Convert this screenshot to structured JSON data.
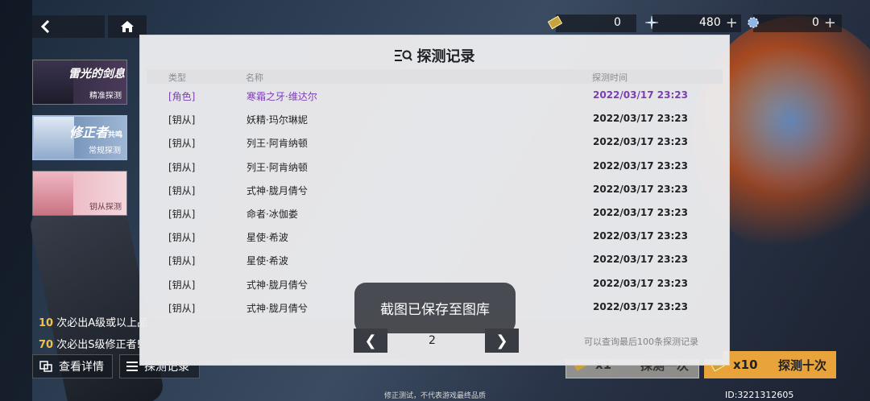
{
  "currencies": [
    {
      "icon": "ticket-icon",
      "value": "0",
      "has_plus": false
    },
    {
      "icon": "crystal-icon",
      "value": "480",
      "has_plus": true
    },
    {
      "icon": "snowflake-gem-icon",
      "value": "0",
      "has_plus": true
    }
  ],
  "banners": [
    {
      "title": "雷光的剑息",
      "subtitle": "精准探测"
    },
    {
      "title": "修正者",
      "title_tag": "共鸣",
      "subtitle": "常规探测"
    },
    {
      "title": "",
      "subtitle": "钥从探测"
    }
  ],
  "hints": [
    {
      "count": "10",
      "text": " 次必出A级或以上品"
    },
    {
      "count": "70",
      "text": " 次必出S级修正者!"
    }
  ],
  "bottom_left": {
    "details_label": "查看详情",
    "record_label": "探测记录"
  },
  "explore": {
    "single_count": "x1",
    "single_label": "探测一次",
    "ten_count": "x10",
    "ten_label": "探测十次"
  },
  "footer_note": "修正测试，不代表游戏最终品质",
  "uid": "ID:3221312605",
  "modal": {
    "title": "探测记录",
    "columns": {
      "type": "类型",
      "name": "名称",
      "time": "探测时间"
    },
    "rows": [
      {
        "type": "[角色]",
        "name": "寒霜之牙·维达尔",
        "time": "2022/03/17 23:23",
        "is_role": true
      },
      {
        "type": "[钥从]",
        "name": "妖精·玛尔琳妮",
        "time": "2022/03/17 23:23",
        "is_role": false
      },
      {
        "type": "[钥从]",
        "name": "列王·阿肯纳顿",
        "time": "2022/03/17 23:23",
        "is_role": false
      },
      {
        "type": "[钥从]",
        "name": "列王·阿肯纳顿",
        "time": "2022/03/17 23:23",
        "is_role": false
      },
      {
        "type": "[钥从]",
        "name": "式神·胧月倩兮",
        "time": "2022/03/17 23:23",
        "is_role": false
      },
      {
        "type": "[钥从]",
        "name": "命者·冰伽娄",
        "time": "2022/03/17 23:23",
        "is_role": false
      },
      {
        "type": "[钥从]",
        "name": "星使·希波",
        "time": "2022/03/17 23:23",
        "is_role": false
      },
      {
        "type": "[钥从]",
        "name": "星使·希波",
        "time": "2022/03/17 23:23",
        "is_role": false
      },
      {
        "type": "[钥从]",
        "name": "式神·胧月倩兮",
        "time": "2022/03/17 23:23",
        "is_role": false
      },
      {
        "type": "[钥从]",
        "name": "式神·胧月倩兮",
        "time": "2022/03/17 23:23",
        "is_role": false
      }
    ],
    "page": "2",
    "prev_label": "❮",
    "next_label": "❯",
    "limit_note": "可以查询最后100条探测记录"
  },
  "toast": "截图已保存至图库"
}
